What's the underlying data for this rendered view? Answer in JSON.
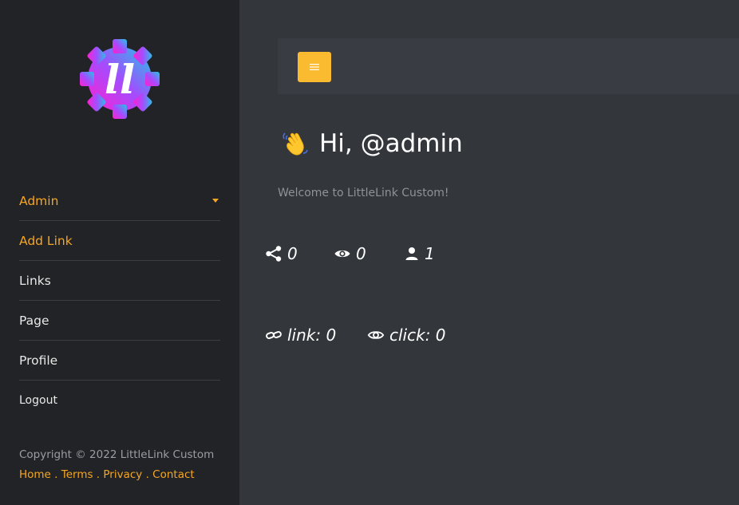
{
  "sidebar": {
    "logo_text": "ll",
    "nav": [
      {
        "label": "Admin"
      },
      {
        "label": "Add Link"
      },
      {
        "label": "Links"
      },
      {
        "label": "Page"
      },
      {
        "label": "Profile"
      },
      {
        "label": "Logout"
      }
    ],
    "copyright": "Copyright © 2022 LittleLink Custom",
    "footer_links": [
      "Home",
      "Terms",
      "Privacy",
      "Contact"
    ],
    "footer_separator": " . "
  },
  "header": {
    "menu_button_icon": "hamburger-icon"
  },
  "main": {
    "greeting": "Hi, @admin",
    "welcome": "Welcome to LittleLink Custom!",
    "stats": {
      "shares": "0",
      "views": "0",
      "users": "1"
    },
    "counts": {
      "link": "link: 0",
      "click": "click: 0"
    }
  },
  "colors": {
    "accent": "#f5a623",
    "button": "#fbbb31",
    "sidebar_bg": "#212326",
    "main_bg": "#33363b"
  }
}
